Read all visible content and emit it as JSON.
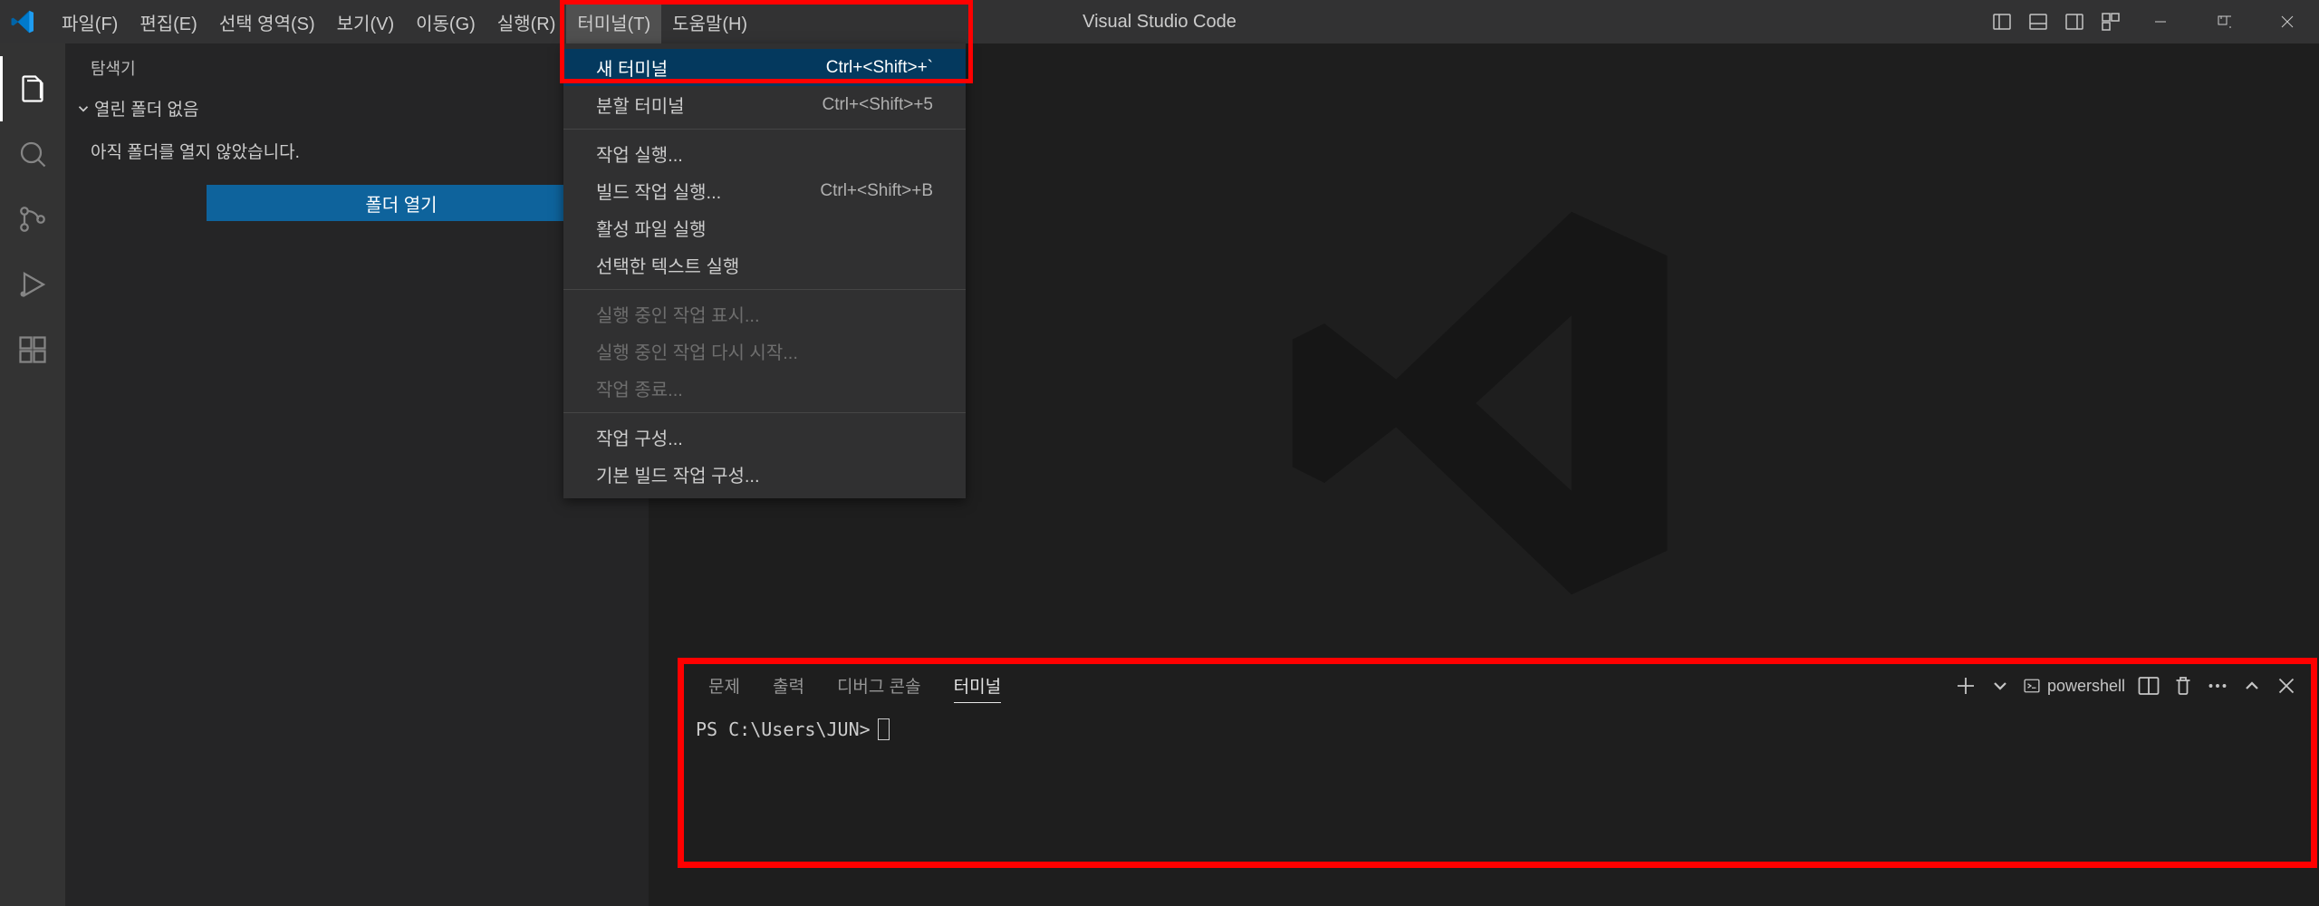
{
  "titlebar": {
    "app_title": "Visual Studio Code",
    "menu": [
      {
        "label": "파일(F)"
      },
      {
        "label": "편집(E)"
      },
      {
        "label": "선택 영역(S)"
      },
      {
        "label": "보기(V)"
      },
      {
        "label": "이동(G)"
      },
      {
        "label": "실행(R)"
      },
      {
        "label": "터미널(T)"
      },
      {
        "label": "도움말(H)"
      }
    ]
  },
  "dropdown": {
    "items": [
      {
        "label": "새 터미널",
        "shortcut": "Ctrl+<Shift>+`",
        "selected": true
      },
      {
        "label": "분할 터미널",
        "shortcut": "Ctrl+<Shift>+5"
      },
      {
        "sep": true
      },
      {
        "label": "작업 실행..."
      },
      {
        "label": "빌드 작업 실행...",
        "shortcut": "Ctrl+<Shift>+B"
      },
      {
        "label": "활성 파일 실행"
      },
      {
        "label": "선택한 텍스트 실행"
      },
      {
        "sep": true
      },
      {
        "label": "실행 중인 작업 표시...",
        "disabled": true
      },
      {
        "label": "실행 중인 작업 다시 시작...",
        "disabled": true
      },
      {
        "label": "작업 종료...",
        "disabled": true
      },
      {
        "sep": true
      },
      {
        "label": "작업 구성..."
      },
      {
        "label": "기본 빌드 작업 구성..."
      }
    ]
  },
  "sidebar": {
    "title": "탐색기",
    "folder_section": "열린 폴더 없음",
    "no_folder_message": "아직 폴더를 열지 않았습니다.",
    "open_folder_label": "폴더 열기"
  },
  "panel": {
    "tabs": [
      {
        "label": "문제"
      },
      {
        "label": "출력"
      },
      {
        "label": "디버그 콘솔"
      },
      {
        "label": "터미널",
        "active": true
      }
    ],
    "terminal_name": "powershell",
    "prompt": "PS C:\\Users\\JUN>"
  }
}
